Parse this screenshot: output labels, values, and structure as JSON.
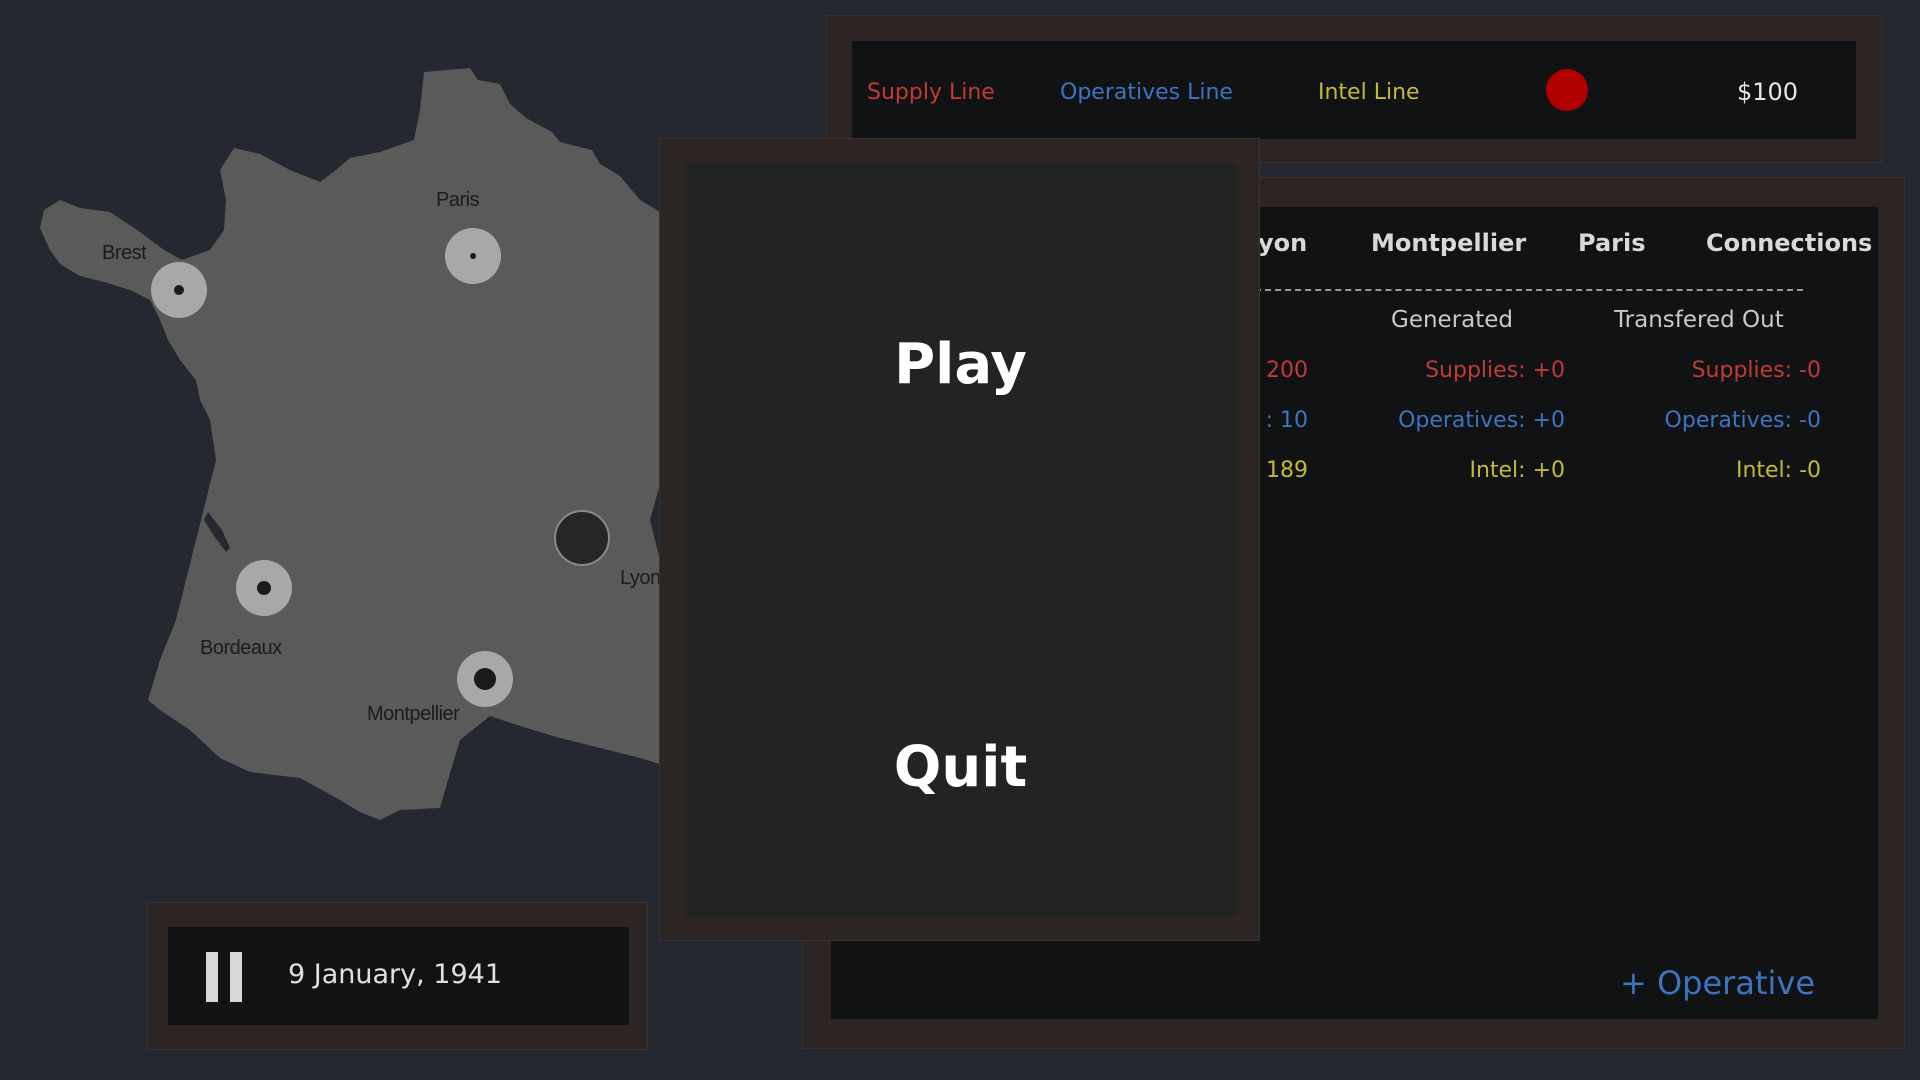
{
  "cities": [
    {
      "name": "Brest"
    },
    {
      "name": "Paris"
    },
    {
      "name": "Bordeaux"
    },
    {
      "name": "Montpellier"
    },
    {
      "name": "Lyon"
    }
  ],
  "top_bar": {
    "supply_label": "Supply Line",
    "operatives_label": "Operatives Line",
    "intel_label": "Intel Line",
    "status_color": "#b00000",
    "money": "$100"
  },
  "stats": {
    "tabs": [
      "yon",
      "Montpellier",
      "Paris",
      "Connections"
    ],
    "headers": {
      "generated": "Generated",
      "transferred_out": "Transfered Out"
    },
    "rows": [
      {
        "partial": "200",
        "generated": "Supplies: +0",
        "transferred": "Supplies: -0",
        "color": "#c03a36"
      },
      {
        "partial": ": 10",
        "generated": "Operatives: +0",
        "transferred": "Operatives: -0",
        "color": "#3d74c0"
      },
      {
        "partial": "189",
        "generated": "Intel: +0",
        "transferred": "Intel: -0",
        "color": "#c4b83a"
      }
    ],
    "add_operative": "+ Operative"
  },
  "menu": {
    "play": "Play",
    "quit": "Quit"
  },
  "clock": {
    "date": "9 January, 1941"
  }
}
